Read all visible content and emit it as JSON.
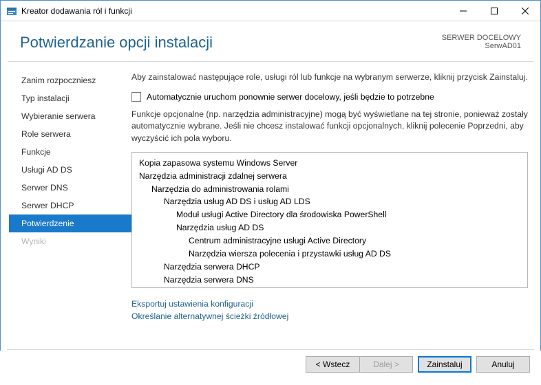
{
  "window": {
    "title": "Kreator dodawania ról i funkcji"
  },
  "header": {
    "title": "Potwierdzanie opcji instalacji",
    "dest_label": "SERWER DOCELOWY",
    "dest_value": "SerwAD01"
  },
  "nav": {
    "items": [
      {
        "label": "Zanim rozpoczniesz",
        "state": "normal"
      },
      {
        "label": "Typ instalacji",
        "state": "normal"
      },
      {
        "label": "Wybieranie serwera",
        "state": "normal"
      },
      {
        "label": "Role serwera",
        "state": "normal"
      },
      {
        "label": "Funkcje",
        "state": "normal"
      },
      {
        "label": "Usługi AD DS",
        "state": "normal"
      },
      {
        "label": "Serwer DNS",
        "state": "normal"
      },
      {
        "label": "Serwer DHCP",
        "state": "normal"
      },
      {
        "label": "Potwierdzenie",
        "state": "selected"
      },
      {
        "label": "Wyniki",
        "state": "disabled"
      }
    ]
  },
  "main": {
    "intro": "Aby zainstalować następujące role, usługi ról lub funkcje na wybranym serwerze, kliknij przycisk Zainstaluj.",
    "checkbox_label": "Automatycznie uruchom ponownie serwer docelowy, jeśli będzie to potrzebne",
    "note": "Funkcje opcjonalne (np. narzędzia administracyjne) mogą być wyświetlane na tej stronie, ponieważ zostały automatycznie wybrane. Jeśli nie chcesz instalować funkcji opcjonalnych, kliknij polecenie Poprzedni, aby wyczyścić ich pola wyboru.",
    "list": [
      {
        "level": 0,
        "text": "Kopia zapasowa systemu Windows Server"
      },
      {
        "level": 0,
        "text": "Narzędzia administracji zdalnej serwera"
      },
      {
        "level": 1,
        "text": "Narzędzia do administrowania rolami"
      },
      {
        "level": 2,
        "text": "Narzędzia usług AD DS i usług AD LDS"
      },
      {
        "level": 3,
        "text": "Moduł usługi Active Directory dla środowiska PowerShell"
      },
      {
        "level": 3,
        "text": "Narzędzia usług AD DS"
      },
      {
        "level": 4,
        "text": "Centrum administracyjne usługi Active Directory"
      },
      {
        "level": 4,
        "text": "Narzędzia wiersza polecenia i przystawki usług AD DS"
      },
      {
        "level": 2,
        "text": "Narzędzia serwera DHCP"
      },
      {
        "level": 2,
        "text": "Narzędzia serwera DNS"
      }
    ],
    "links": {
      "export": "Eksportuj ustawienia konfiguracji",
      "altpath": "Określanie alternatywnej ścieżki źródłowej"
    }
  },
  "footer": {
    "back": "< Wstecz",
    "next": "Dalej >",
    "install": "Zainstaluj",
    "cancel": "Anuluj"
  }
}
